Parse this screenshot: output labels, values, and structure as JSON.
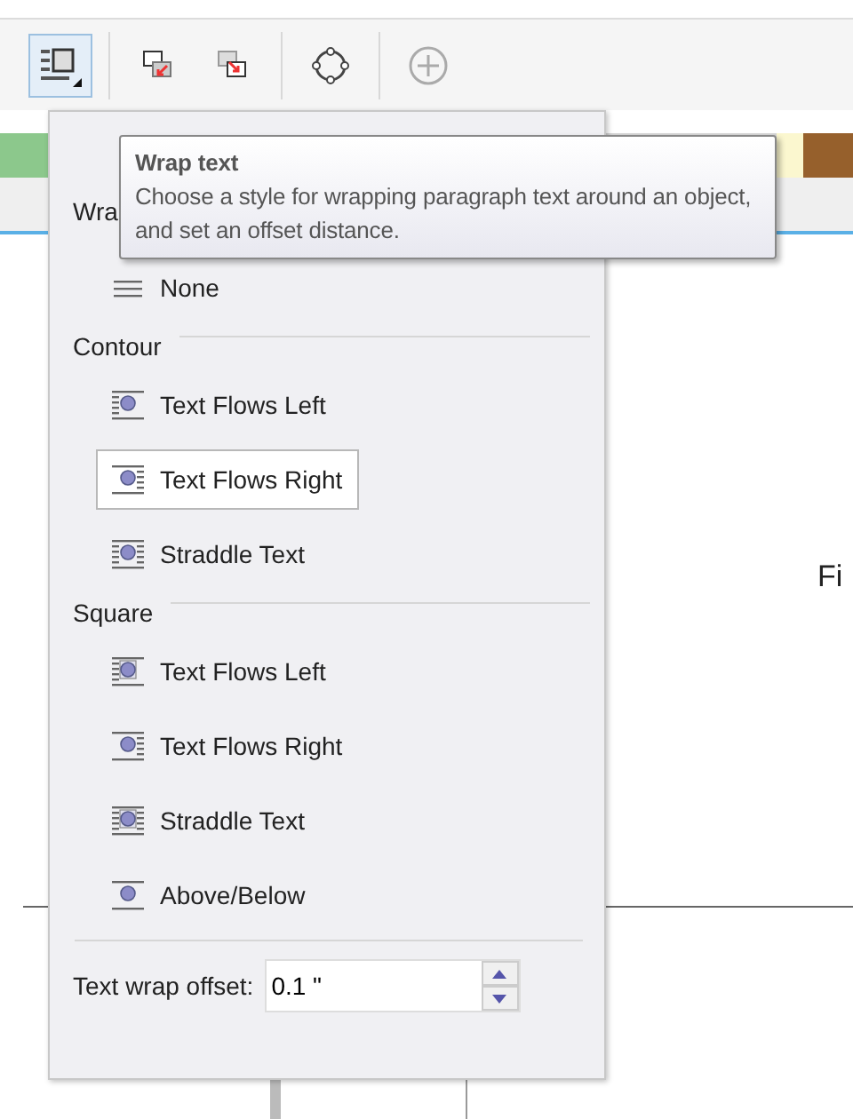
{
  "toolbar": {
    "buttons": [
      {
        "kind": "wrap",
        "selected": true
      },
      {
        "kind": "back",
        "selected": false
      },
      {
        "kind": "front",
        "selected": false
      },
      {
        "kind": "nodes",
        "selected": false
      },
      {
        "kind": "add",
        "selected": false
      }
    ]
  },
  "palette": [
    {
      "color": "#8cc88c"
    },
    {
      "color": "#fbf7cf"
    },
    {
      "color": "#96602c"
    }
  ],
  "canvas": {
    "text": "Fi"
  },
  "wrap_menu": {
    "header": "Wra",
    "none_item": {
      "label": "None",
      "kind": "none",
      "selected": false
    },
    "sections": [
      {
        "title": "Contour",
        "items": [
          {
            "label": "Text Flows Left",
            "kind": "flows_left",
            "selected": false
          },
          {
            "label": "Text Flows Right",
            "kind": "flows_right",
            "selected": true
          },
          {
            "label": "Straddle Text",
            "kind": "straddle",
            "selected": false
          }
        ]
      },
      {
        "title": "Square",
        "items": [
          {
            "label": "Text Flows Left",
            "kind": "sq_left",
            "selected": false
          },
          {
            "label": "Text Flows Right",
            "kind": "sq_right",
            "selected": false
          },
          {
            "label": "Straddle Text",
            "kind": "sq_straddle",
            "selected": false
          },
          {
            "label": "Above/Below",
            "kind": "above_below",
            "selected": false
          }
        ]
      }
    ],
    "offset": {
      "label": "Text wrap offset:",
      "value": "0.1 \""
    }
  },
  "tooltip": {
    "title": "Wrap text",
    "text": "Choose a style for wrapping paragraph text around an object, and set an offset distance."
  }
}
